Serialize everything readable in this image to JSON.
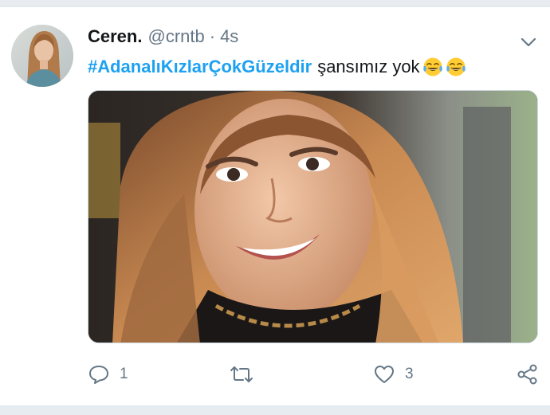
{
  "tweet": {
    "display_name": "Ceren.",
    "handle": "@crntb",
    "separator": "·",
    "timestamp": "4s",
    "hashtag": "#AdanalıKızlarÇokGüzeldir",
    "text": "şansımız yok",
    "emojis": [
      "face-with-tears-of-joy-icon",
      "face-with-tears-of-joy-icon"
    ]
  },
  "actions": {
    "reply_count": "1",
    "retweet_count": "",
    "like_count": "3"
  },
  "colors": {
    "link": "#1da1f2",
    "text": "#14171a",
    "secondary": "#657786",
    "background": "#e6ecf0"
  }
}
